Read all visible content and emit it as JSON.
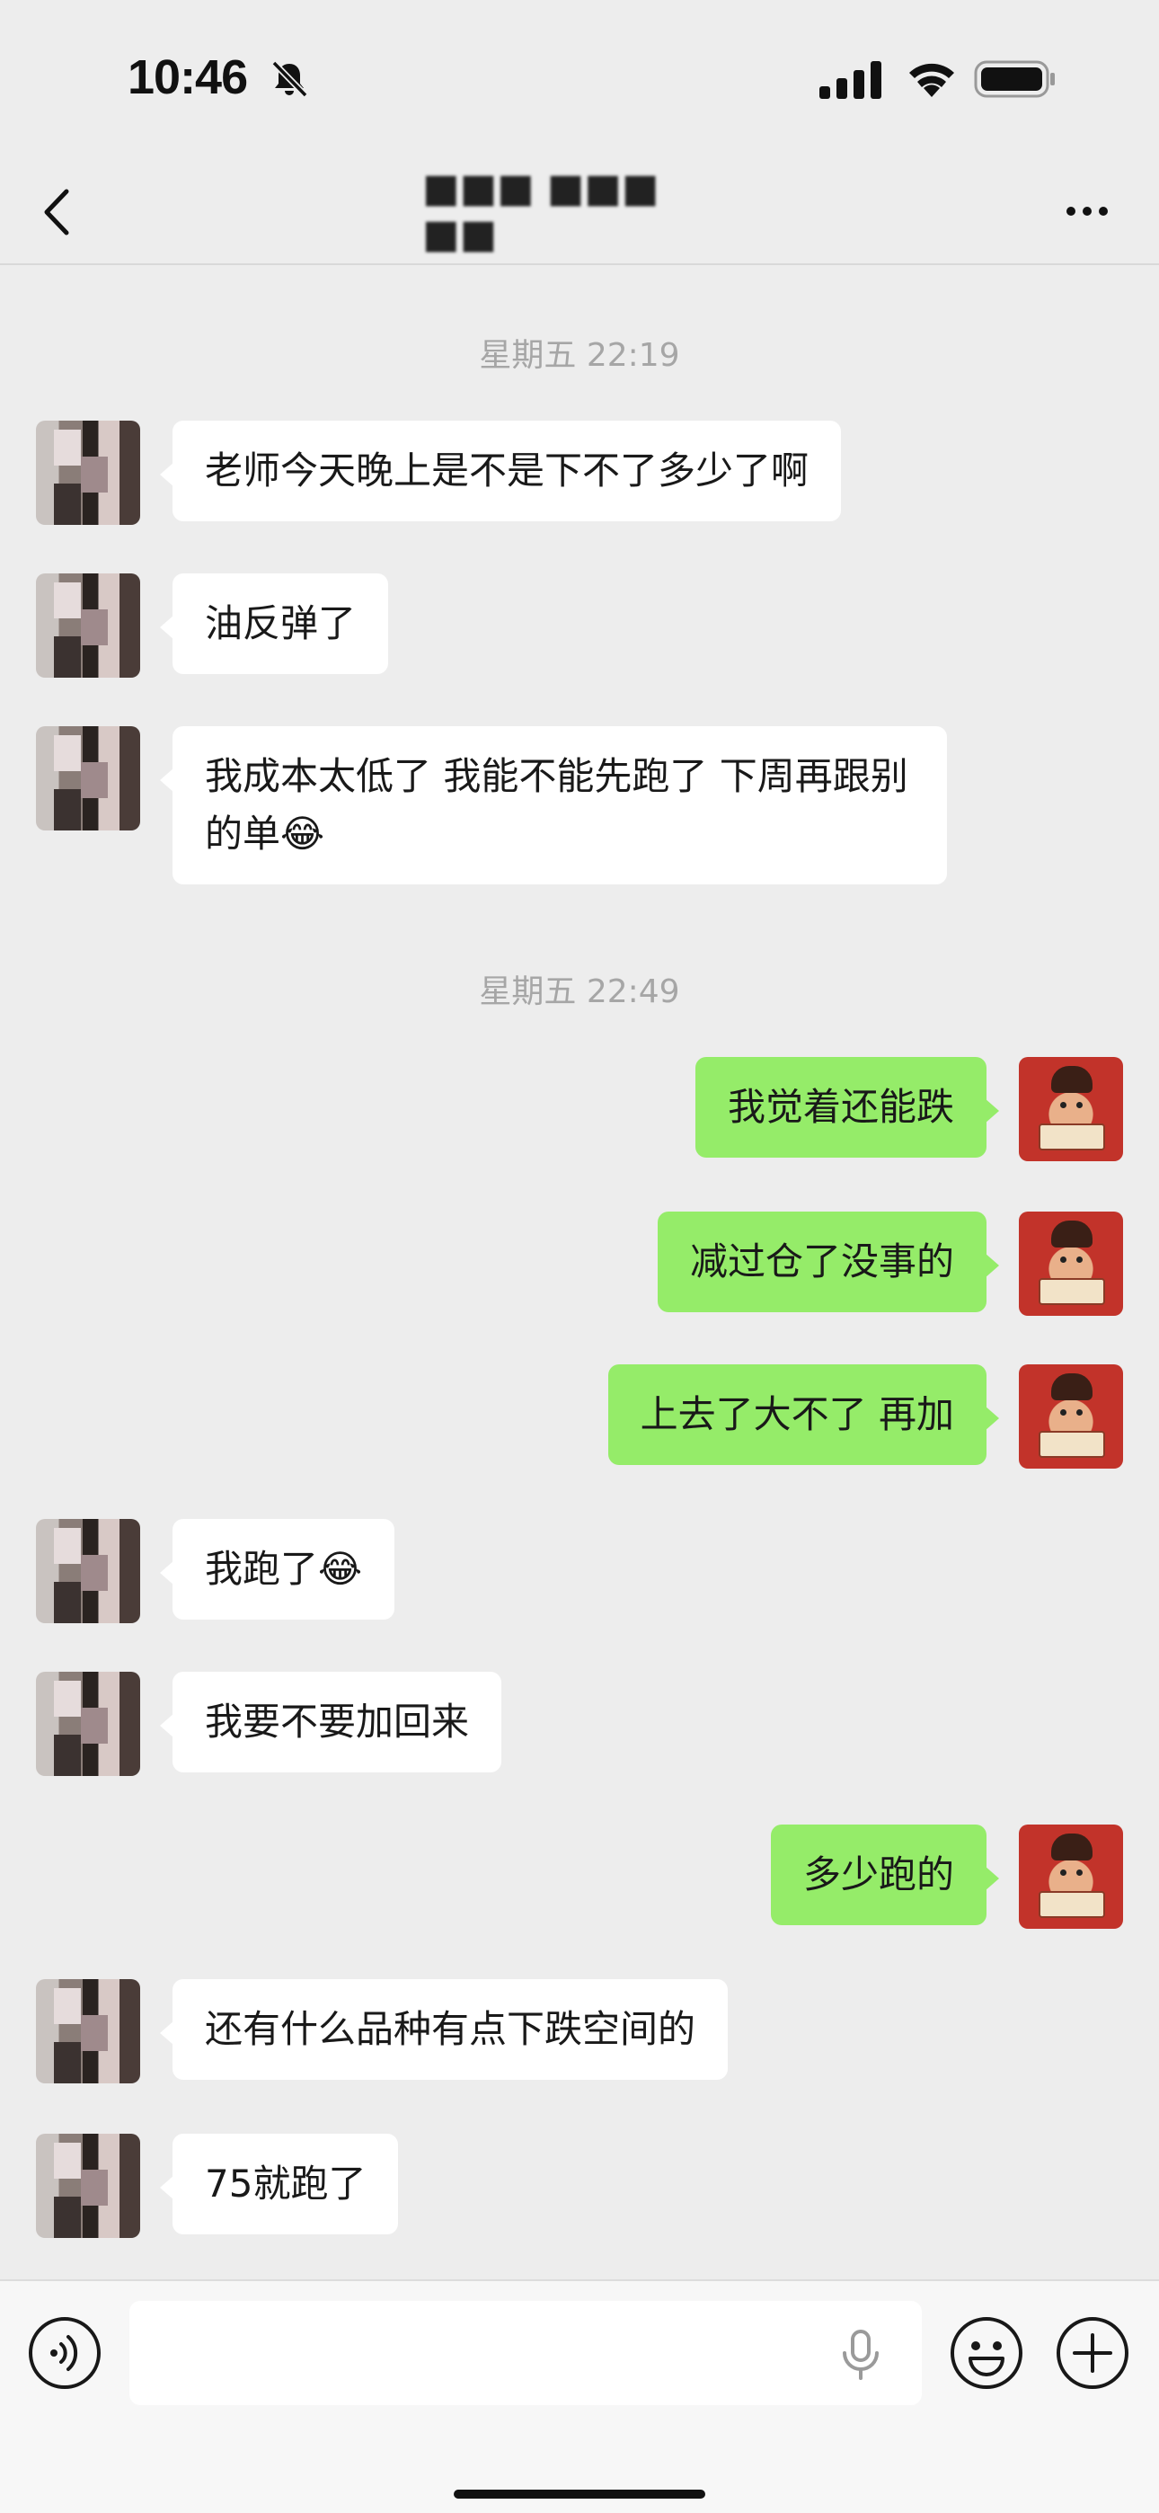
{
  "status_bar": {
    "time": "10:46",
    "icons": [
      "bell-off-icon",
      "signal-icon",
      "wifi-icon",
      "battery-icon"
    ]
  },
  "nav": {
    "title": "■■■ ■■■ ■■",
    "back_icon": "chevron-left-icon",
    "more_icon": "more-icon"
  },
  "messages": [
    {
      "type": "timestamp",
      "text": "星期五 22:19"
    },
    {
      "type": "msg",
      "side": "left",
      "text": "老师今天晚上是不是下不了多少了啊"
    },
    {
      "type": "msg",
      "side": "left",
      "text": "油反弹了"
    },
    {
      "type": "msg",
      "side": "left",
      "text": "我成本太低了 我能不能先跑了 下周再跟别的单😂"
    },
    {
      "type": "timestamp",
      "text": "星期五 22:49"
    },
    {
      "type": "msg",
      "side": "right",
      "text": "我觉着还能跌"
    },
    {
      "type": "msg",
      "side": "right",
      "text": "减过仓了没事的"
    },
    {
      "type": "msg",
      "side": "right",
      "text": "上去了大不了 再加"
    },
    {
      "type": "msg",
      "side": "left",
      "text": "我跑了😂"
    },
    {
      "type": "msg",
      "side": "left",
      "text": "我要不要加回来"
    },
    {
      "type": "msg",
      "side": "right",
      "text": "多少跑的"
    },
    {
      "type": "msg",
      "side": "left",
      "text": "还有什么品种有点下跌空间的"
    },
    {
      "type": "msg",
      "side": "left",
      "text": "75就跑了"
    }
  ],
  "input_bar": {
    "value": "",
    "icons": [
      "voice-icon",
      "microphone-icon",
      "emoji-icon",
      "plus-icon"
    ]
  },
  "colors": {
    "background": "#ededed",
    "bubble_self": "#95ec69",
    "bubble_other": "#ffffff",
    "timestamp": "#a6a6a6"
  }
}
